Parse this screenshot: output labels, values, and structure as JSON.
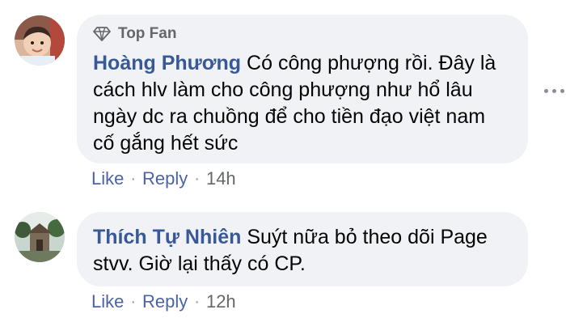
{
  "comments": [
    {
      "badge": "Top Fan",
      "author": "Hoàng Phương",
      "text_lines": [
        "Có công phượng rồi. Đây là",
        "cách hlv làm cho công phượng như hổ lâu",
        "ngày dc ra chuồng để cho tiền đạo việt nam",
        "cố gắng hết sức"
      ],
      "like_label": "Like",
      "reply_label": "Reply",
      "time": "14h"
    },
    {
      "author": "Thích Tự Nhiên",
      "text_lines": [
        "Suýt nữa bỏ theo dõi Page",
        "stvv. Giờ lại thấy có CP."
      ],
      "like_label": "Like",
      "reply_label": "Reply",
      "time": "12h"
    }
  ],
  "separator": "·",
  "colors": {
    "bubble": "#f0f2f5",
    "author": "#385898",
    "action": "#4b64a6",
    "muted": "#65676b"
  }
}
